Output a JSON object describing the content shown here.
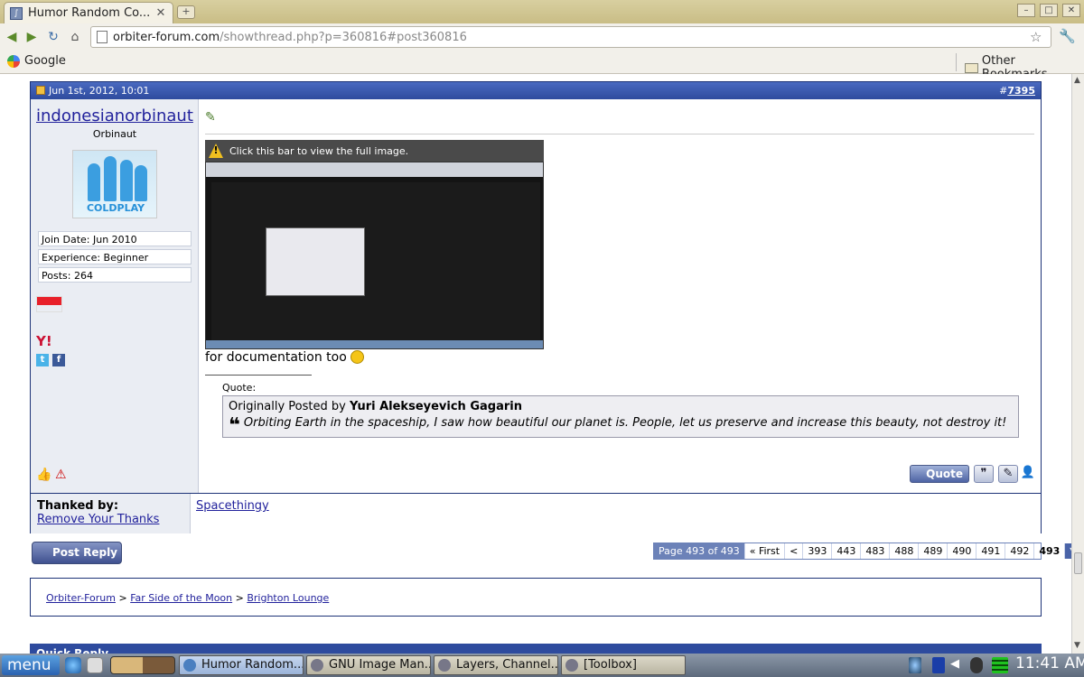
{
  "browser": {
    "tab_title": "Humor Random Co...",
    "url_domain": "orbiter-forum.com",
    "url_path": "/showthread.php?p=360816#post360816",
    "bookmarks": [
      "Google"
    ],
    "other_bookmarks": "Other Bookmarks"
  },
  "post": {
    "date": "Jun 1st, 2012, 10:01",
    "number_prefix": "#",
    "number": "7395",
    "username": "indonesianorbinaut",
    "user_title": "Orbinaut",
    "avatar_text": "COLDPLAY",
    "join_date": "Join Date: Jun 2010",
    "experience": "Experience: Beginner",
    "posts": "Posts: 264",
    "image_bar_text": "Click this bar to view the full image.",
    "body_text": "for documentation too",
    "quote_label": "Quote:",
    "quote_prefix": "Originally Posted by",
    "quote_author": "Yuri Alekseyevich Gagarin",
    "quote_text": "Orbiting Earth in the spaceship, I saw how beautiful our planet is. People, let us preserve and increase this beauty, not destroy it!",
    "quote_button": "Quote"
  },
  "thanks": {
    "label": "Thanked by:",
    "remove_link": "Remove Your Thanks",
    "thanked_user": "Spacethingy"
  },
  "post_reply": "Post Reply",
  "pagination": {
    "page_label": "Page 493 of 493",
    "first": "« First",
    "prev": "<",
    "pages": [
      "393",
      "443",
      "483",
      "488",
      "489",
      "490",
      "491",
      "492"
    ],
    "current": "493"
  },
  "breadcrumb": {
    "items": [
      "Orbiter-Forum",
      "Far Side of the Moon",
      "Brighton Lounge"
    ],
    "separator": ">"
  },
  "quick_reply": "Quick Reply",
  "taskbar": {
    "menu": "menu",
    "apps": [
      "Humor Random...",
      "GNU Image Man...",
      "Layers, Channel...",
      "[Toolbox]"
    ],
    "clock": "11:41 AM"
  }
}
